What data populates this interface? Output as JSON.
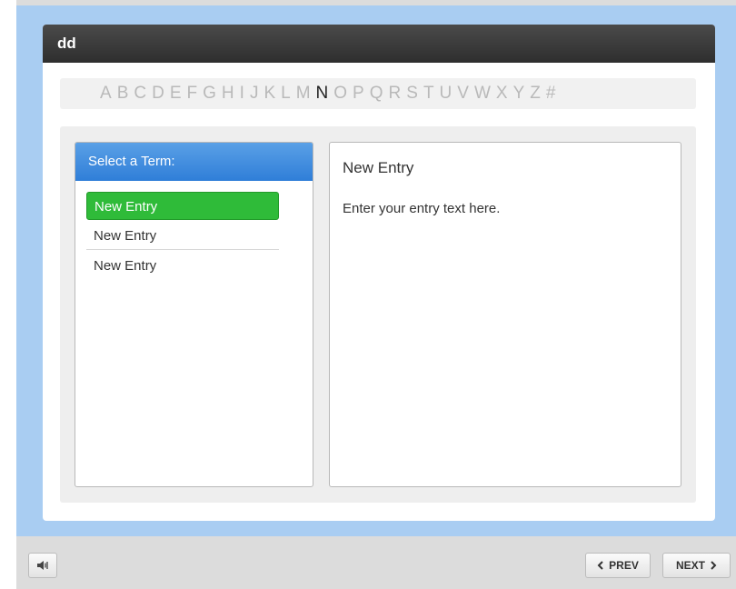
{
  "window": {
    "title": "dd"
  },
  "alphabet": {
    "letters": [
      "A",
      "B",
      "C",
      "D",
      "E",
      "F",
      "G",
      "H",
      "I",
      "J",
      "K",
      "L",
      "M",
      "N",
      "O",
      "P",
      "Q",
      "R",
      "S",
      "T",
      "U",
      "V",
      "W",
      "X",
      "Y",
      "Z",
      "#"
    ],
    "active": "N"
  },
  "term_list": {
    "header": "Select a Term:",
    "items": [
      "New Entry",
      "New Entry",
      "New Entry"
    ],
    "selected_index": 0
  },
  "entry": {
    "title": "New Entry",
    "text": "Enter your entry text here."
  },
  "nav": {
    "prev_label": "PREV",
    "next_label": "NEXT"
  },
  "icons": {
    "sound": "speaker-icon",
    "prev": "chevron-left-icon",
    "next": "chevron-right-icon"
  },
  "colors": {
    "selected": "#2fbb39",
    "header_blue": "#2f7ed8",
    "stage": "#a9cdf2"
  }
}
